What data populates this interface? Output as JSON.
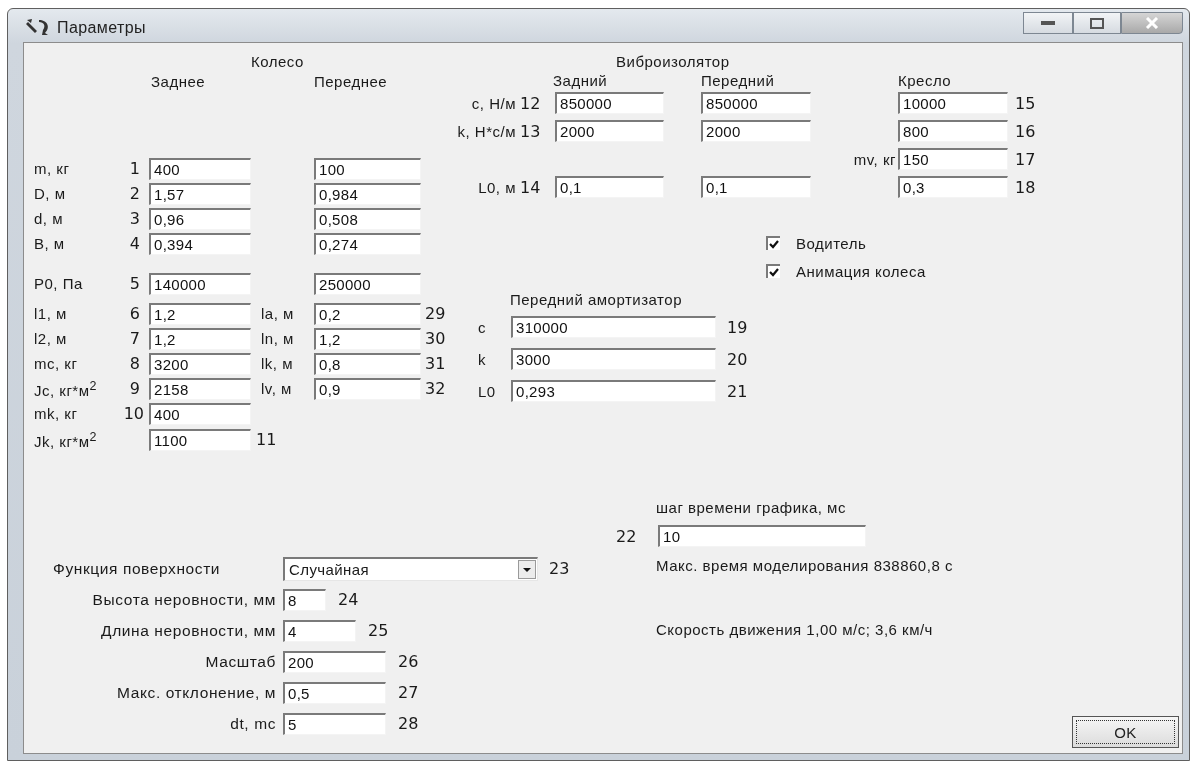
{
  "window": {
    "title": "Параметры"
  },
  "wheel": {
    "title": "Колесо",
    "columns": [
      "Заднее",
      "Переднее"
    ],
    "rows": [
      {
        "label": "m, кг",
        "number": "1",
        "rear": "400",
        "front": "100"
      },
      {
        "label": "D, м",
        "number": "2",
        "rear": "1,57",
        "front": "0,984"
      },
      {
        "label": "d, м",
        "number": "3",
        "rear": "0,96",
        "front": "0,508"
      },
      {
        "label": "B, м",
        "number": "4",
        "rear": "0,394",
        "front": "0,274"
      },
      {
        "label": "P0, Па",
        "number": "5",
        "rear": "140000",
        "front": "250000"
      }
    ],
    "extra_rows": [
      {
        "kind": "pair",
        "label": "l1, м",
        "number": "6",
        "value": "1,2",
        "label_2": "la, м",
        "value_2": "0,2",
        "number_2": "29"
      },
      {
        "kind": "pair",
        "label": "l2, м",
        "number": "7",
        "value": "1,2",
        "label_2": "ln, м",
        "value_2": "1,2",
        "number_2": "30"
      },
      {
        "kind": "pair",
        "label": "mc, кг",
        "number": "8",
        "value": "3200",
        "label_2": "lk, м",
        "value_2": "0,8",
        "number_2": "31"
      },
      {
        "kind": "pair",
        "label": "Jc, кг*м$^{2}$",
        "number": "9",
        "value": "2158",
        "label_2": "lv, м",
        "value_2": "0,9",
        "number_2": "32"
      },
      {
        "kind": "single",
        "label": "mk, кг",
        "number": "10",
        "value": "400"
      },
      {
        "kind": "trailing",
        "label": "Jk, кг*м$^{2}$",
        "number": "11",
        "value": "1100"
      }
    ]
  },
  "vibro_isolator": {
    "title": "Виброизолятор",
    "columns": [
      "Задний",
      "Передний",
      "Кресло"
    ],
    "rows": [
      {
        "label": "c, Н/м",
        "number": "12",
        "rear": "850000",
        "front": "850000",
        "seat": "10000",
        "seat_number": "15"
      },
      {
        "label": "k, Н*с/м",
        "number": "13",
        "rear": "2000",
        "front": "2000",
        "seat": "800",
        "seat_number": "16"
      },
      {
        "seat_label": "mv, кг",
        "seat": "150",
        "seat_number": "17"
      },
      {
        "label": "L0, м",
        "number": "14",
        "rear": "0,1",
        "front": "0,1",
        "seat": "0,3",
        "seat_number": "18"
      }
    ]
  },
  "checkboxes": [
    {
      "label": "Водитель",
      "checked": true
    },
    {
      "label": "Анимация колеса",
      "checked": true
    }
  ],
  "front_shock": {
    "title": "Передний амортизатор",
    "rows": [
      {
        "label": "c",
        "value": "310000",
        "number": "19"
      },
      {
        "label": "k",
        "value": "3000",
        "number": "20"
      },
      {
        "label": "L0",
        "value": "0,293",
        "number": "21"
      }
    ]
  },
  "surface": {
    "function": {
      "label": "Функция поверхности",
      "value": "Случайная",
      "number": "23"
    },
    "rows": [
      {
        "label": "Высота неровности, мм",
        "value": "8",
        "number": "24"
      },
      {
        "label": "Длина неровности, мм",
        "value": "4",
        "number": "25"
      },
      {
        "label": "Масштаб",
        "value": "200",
        "number": "26"
      },
      {
        "label": "Макс. отклонение, м",
        "value": "0,5",
        "number": "27"
      },
      {
        "label": "dt, mc",
        "value": "5",
        "number": "28"
      }
    ]
  },
  "time": {
    "label": "шаг времени графика, мс",
    "number": "22",
    "value": "10",
    "max_time": "Макс. время моделирования 838860,8 с",
    "speed": "Скорость движения 1,00 м/с; 3,6 км/ч"
  },
  "buttons": [
    "OK"
  ]
}
